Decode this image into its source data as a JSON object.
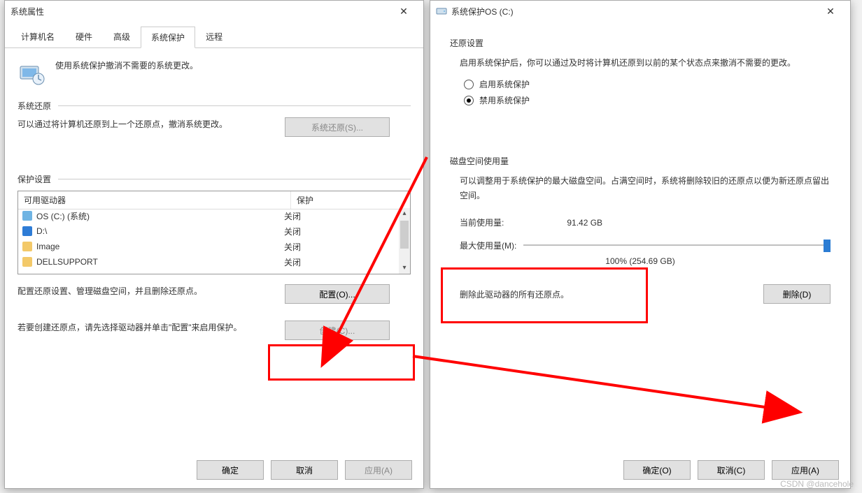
{
  "leftDialog": {
    "title": "系统属性",
    "tabs": [
      "计算机名",
      "硬件",
      "高级",
      "系统保护",
      "远程"
    ],
    "activeTab": 3,
    "introText": "使用系统保护撤消不需要的系统更改。",
    "section1": {
      "heading": "系统还原",
      "desc": "可以通过将计算机还原到上一个还原点，撤消系统更改。",
      "button": "系统还原(S)..."
    },
    "section2": {
      "heading": "保护设置",
      "colDrive": "可用驱动器",
      "colStatus": "保护",
      "drives": [
        {
          "name": "OS (C:) (系统)",
          "status": "关闭",
          "iconType": "drive"
        },
        {
          "name": "D:\\",
          "status": "关闭",
          "iconType": "music"
        },
        {
          "name": "Image",
          "status": "关闭",
          "iconType": "folder"
        },
        {
          "name": "DELLSUPPORT",
          "status": "关闭",
          "iconType": "folder"
        }
      ],
      "configText": "配置还原设置、管理磁盘空间，并且删除还原点。",
      "configBtn": "配置(O)...",
      "createText": "若要创建还原点，请先选择驱动器并单击\"配置\"来启用保护。",
      "createBtn": "创建(C)..."
    },
    "buttons": {
      "ok": "确定",
      "cancel": "取消",
      "apply": "应用(A)"
    }
  },
  "rightDialog": {
    "title": "系统保护OS (C:)",
    "restore": {
      "heading": "还原设置",
      "desc": "启用系统保护后，你可以通过及时将计算机还原到以前的某个状态点来撤消不需要的更改。",
      "optEnable": "启用系统保护",
      "optDisable": "禁用系统保护"
    },
    "disk": {
      "heading": "磁盘空间使用量",
      "desc": "可以调整用于系统保护的最大磁盘空间。占满空间时，系统将删除较旧的还原点以便为新还原点留出空间。",
      "currentLabel": "当前使用量:",
      "currentValue": "91.42 GB",
      "maxLabel": "最大使用量(M):",
      "sliderValue": "100% (254.69 GB)"
    },
    "delete": {
      "desc": "删除此驱动器的所有还原点。",
      "btn": "删除(D)"
    },
    "buttons": {
      "ok": "确定(O)",
      "cancel": "取消(C)",
      "apply": "应用(A)"
    }
  },
  "watermark": "CSDN @dancehole"
}
